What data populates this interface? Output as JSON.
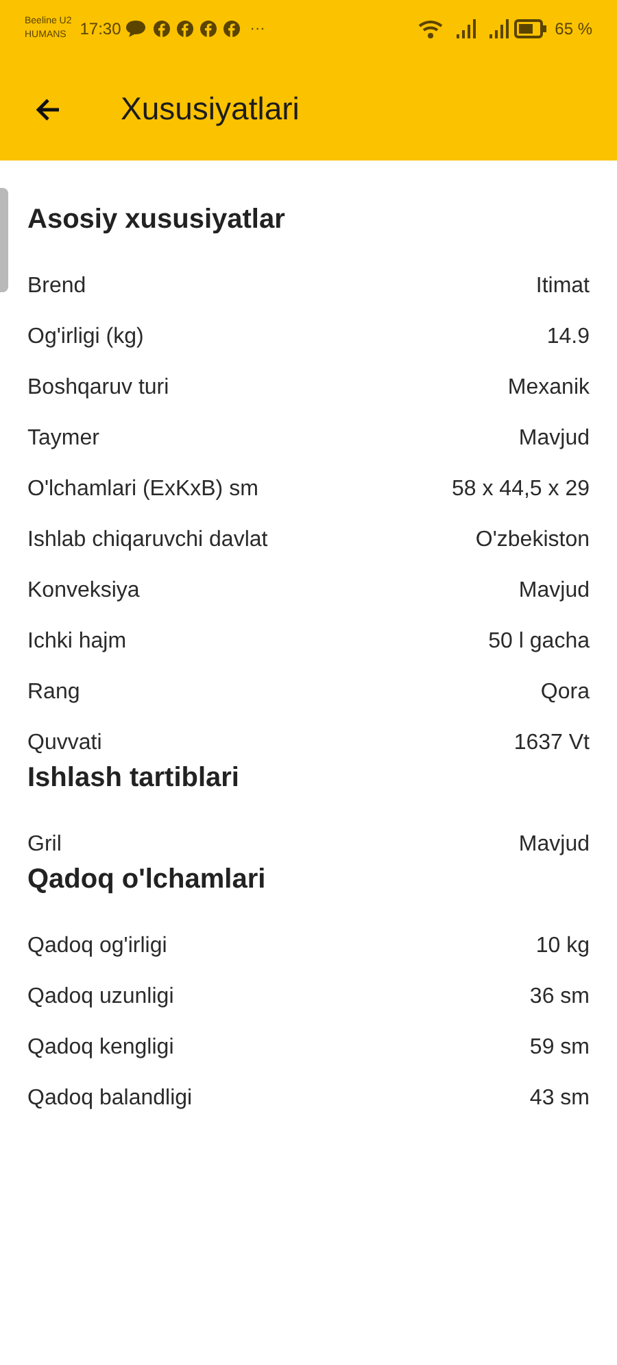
{
  "status_bar": {
    "carrier_line_1": "Beeline U2",
    "carrier_line_2": "HUMANS",
    "time": "17:30",
    "more": "···",
    "battery_percent": "65 %"
  },
  "app_bar": {
    "title": "Xususiyatlari"
  },
  "sections": [
    {
      "title": "Asosiy xususiyatlar",
      "rows": [
        {
          "label": "Brend",
          "value": "Itimat"
        },
        {
          "label": "Og'irligi (kg)",
          "value": "14.9"
        },
        {
          "label": "Boshqaruv turi",
          "value": "Mexanik"
        },
        {
          "label": "Taymer",
          "value": "Mavjud"
        },
        {
          "label": "O'lchamlari (ExKxB) sm",
          "value": "58 x 44,5 x 29"
        },
        {
          "label": "Ishlab chiqaruvchi davlat",
          "value": "O'zbekiston"
        },
        {
          "label": "Konveksiya",
          "value": "Mavjud"
        },
        {
          "label": "Ichki hajm",
          "value": "50 l gacha"
        },
        {
          "label": "Rang",
          "value": "Qora"
        },
        {
          "label": "Quvvati",
          "value": "1637 Vt"
        }
      ]
    },
    {
      "title": "Ishlash tartiblari",
      "rows": [
        {
          "label": "Gril",
          "value": "Mavjud"
        }
      ]
    },
    {
      "title": "Qadoq o'lchamlari",
      "rows": [
        {
          "label": "Qadoq og'irligi",
          "value": "10 kg"
        },
        {
          "label": "Qadoq uzunligi",
          "value": "36 sm"
        },
        {
          "label": "Qadoq kengligi",
          "value": "59 sm"
        },
        {
          "label": "Qadoq balandligi",
          "value": "43 sm"
        }
      ]
    }
  ]
}
